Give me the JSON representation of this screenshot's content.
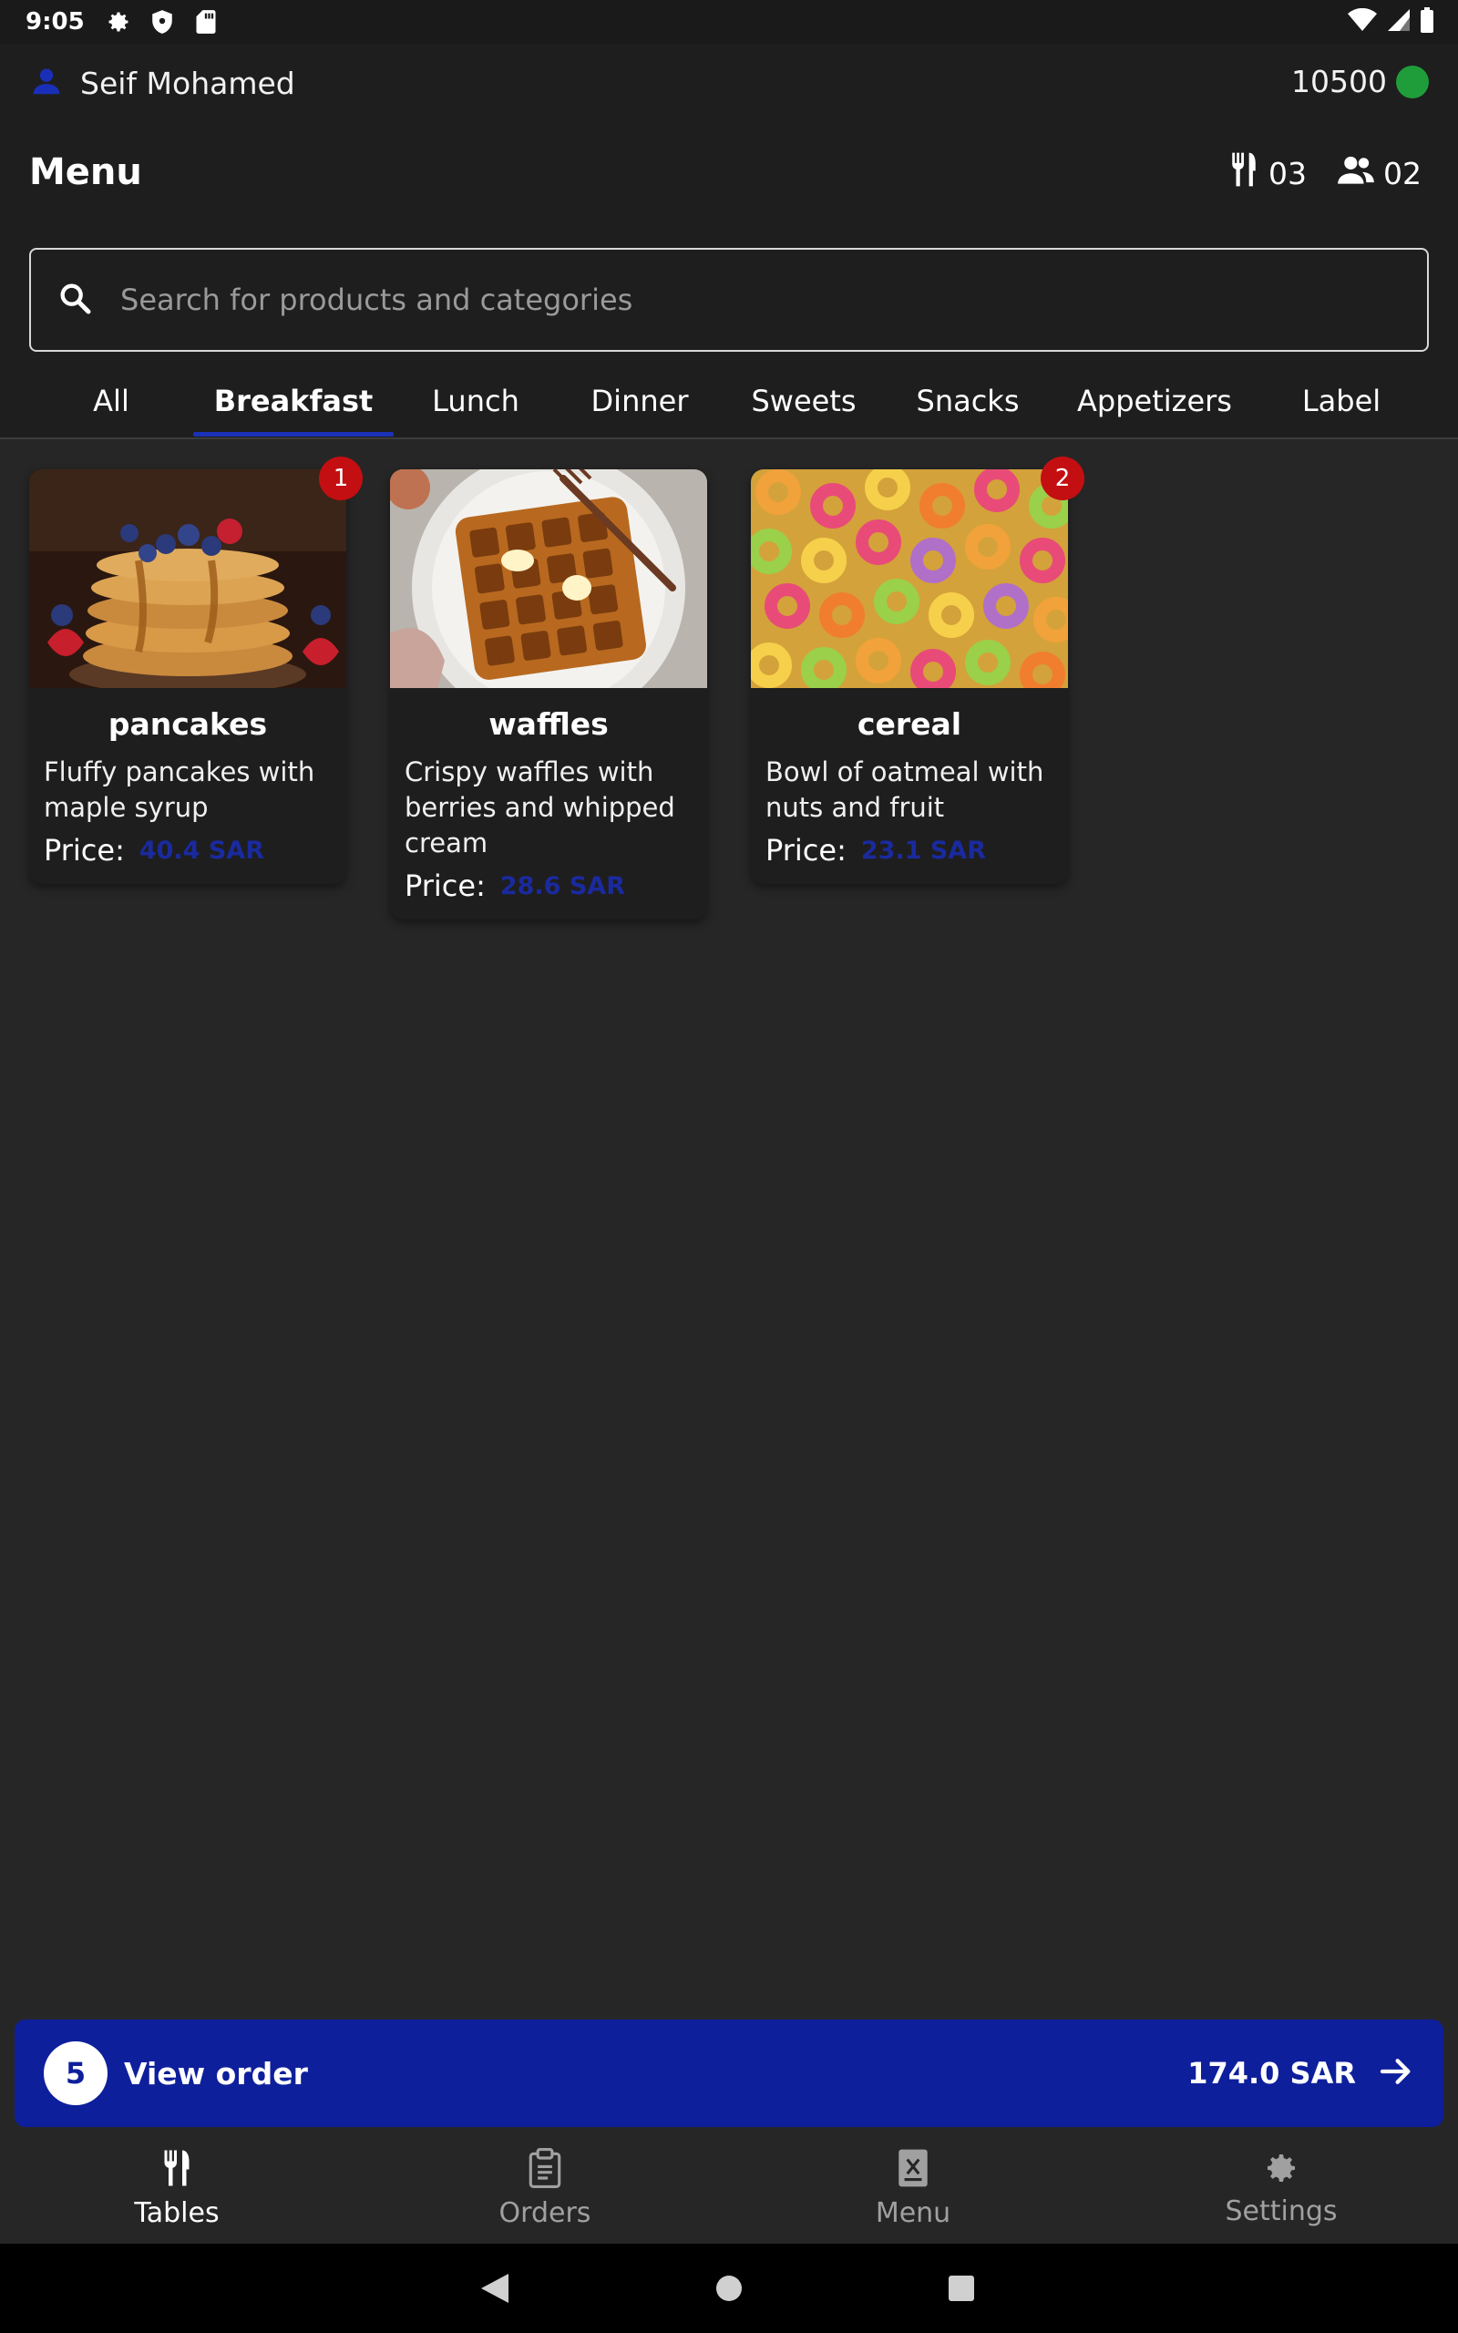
{
  "status_bar": {
    "time": "9:05",
    "icons_left": [
      "gear-icon",
      "shield-icon",
      "sd-card-icon"
    ],
    "icons_right": [
      "wifi-icon",
      "signal-icon",
      "battery-icon"
    ]
  },
  "header": {
    "user_name": "Seif Mohamed",
    "points": "10500",
    "online_color": "#1f9d3a",
    "title": "Menu",
    "tables_count": "03",
    "guests_count": "02"
  },
  "search": {
    "placeholder": "Search for products and categories",
    "value": ""
  },
  "tabs": [
    {
      "label": "All",
      "active": false
    },
    {
      "label": "Breakfast",
      "active": true
    },
    {
      "label": "Lunch",
      "active": false
    },
    {
      "label": "Dinner",
      "active": false
    },
    {
      "label": "Sweets",
      "active": false
    },
    {
      "label": "Snacks",
      "active": false
    },
    {
      "label": "Appetizers",
      "active": false
    },
    {
      "label": "Label",
      "active": false
    }
  ],
  "products": [
    {
      "name": "pancakes",
      "description": "Fluffy pancakes with maple syrup",
      "price_label": "Price:",
      "price": "40.4 SAR",
      "quantity": "1"
    },
    {
      "name": "waffles",
      "description": "Crispy waffles with berries and whipped cream",
      "price_label": "Price:",
      "price": "28.6 SAR",
      "quantity": ""
    },
    {
      "name": "cereal",
      "description": "Bowl of oatmeal with nuts and fruit",
      "price_label": "Price:",
      "price": "23.1 SAR",
      "quantity": "2"
    }
  ],
  "order_bar": {
    "count": "5",
    "label": "View order",
    "total": "174.0 SAR"
  },
  "bottom_nav": [
    {
      "label": "Tables",
      "icon": "fork-knife-icon",
      "active": true
    },
    {
      "label": "Orders",
      "icon": "clipboard-icon",
      "active": false
    },
    {
      "label": "Menu",
      "icon": "menu-book-icon",
      "active": false
    },
    {
      "label": "Settings",
      "icon": "gear-icon",
      "active": false
    }
  ],
  "colors": {
    "accent": "#0e1f9c",
    "price": "#1a2a9e",
    "badge": "#c40f12",
    "background": "#262626"
  }
}
